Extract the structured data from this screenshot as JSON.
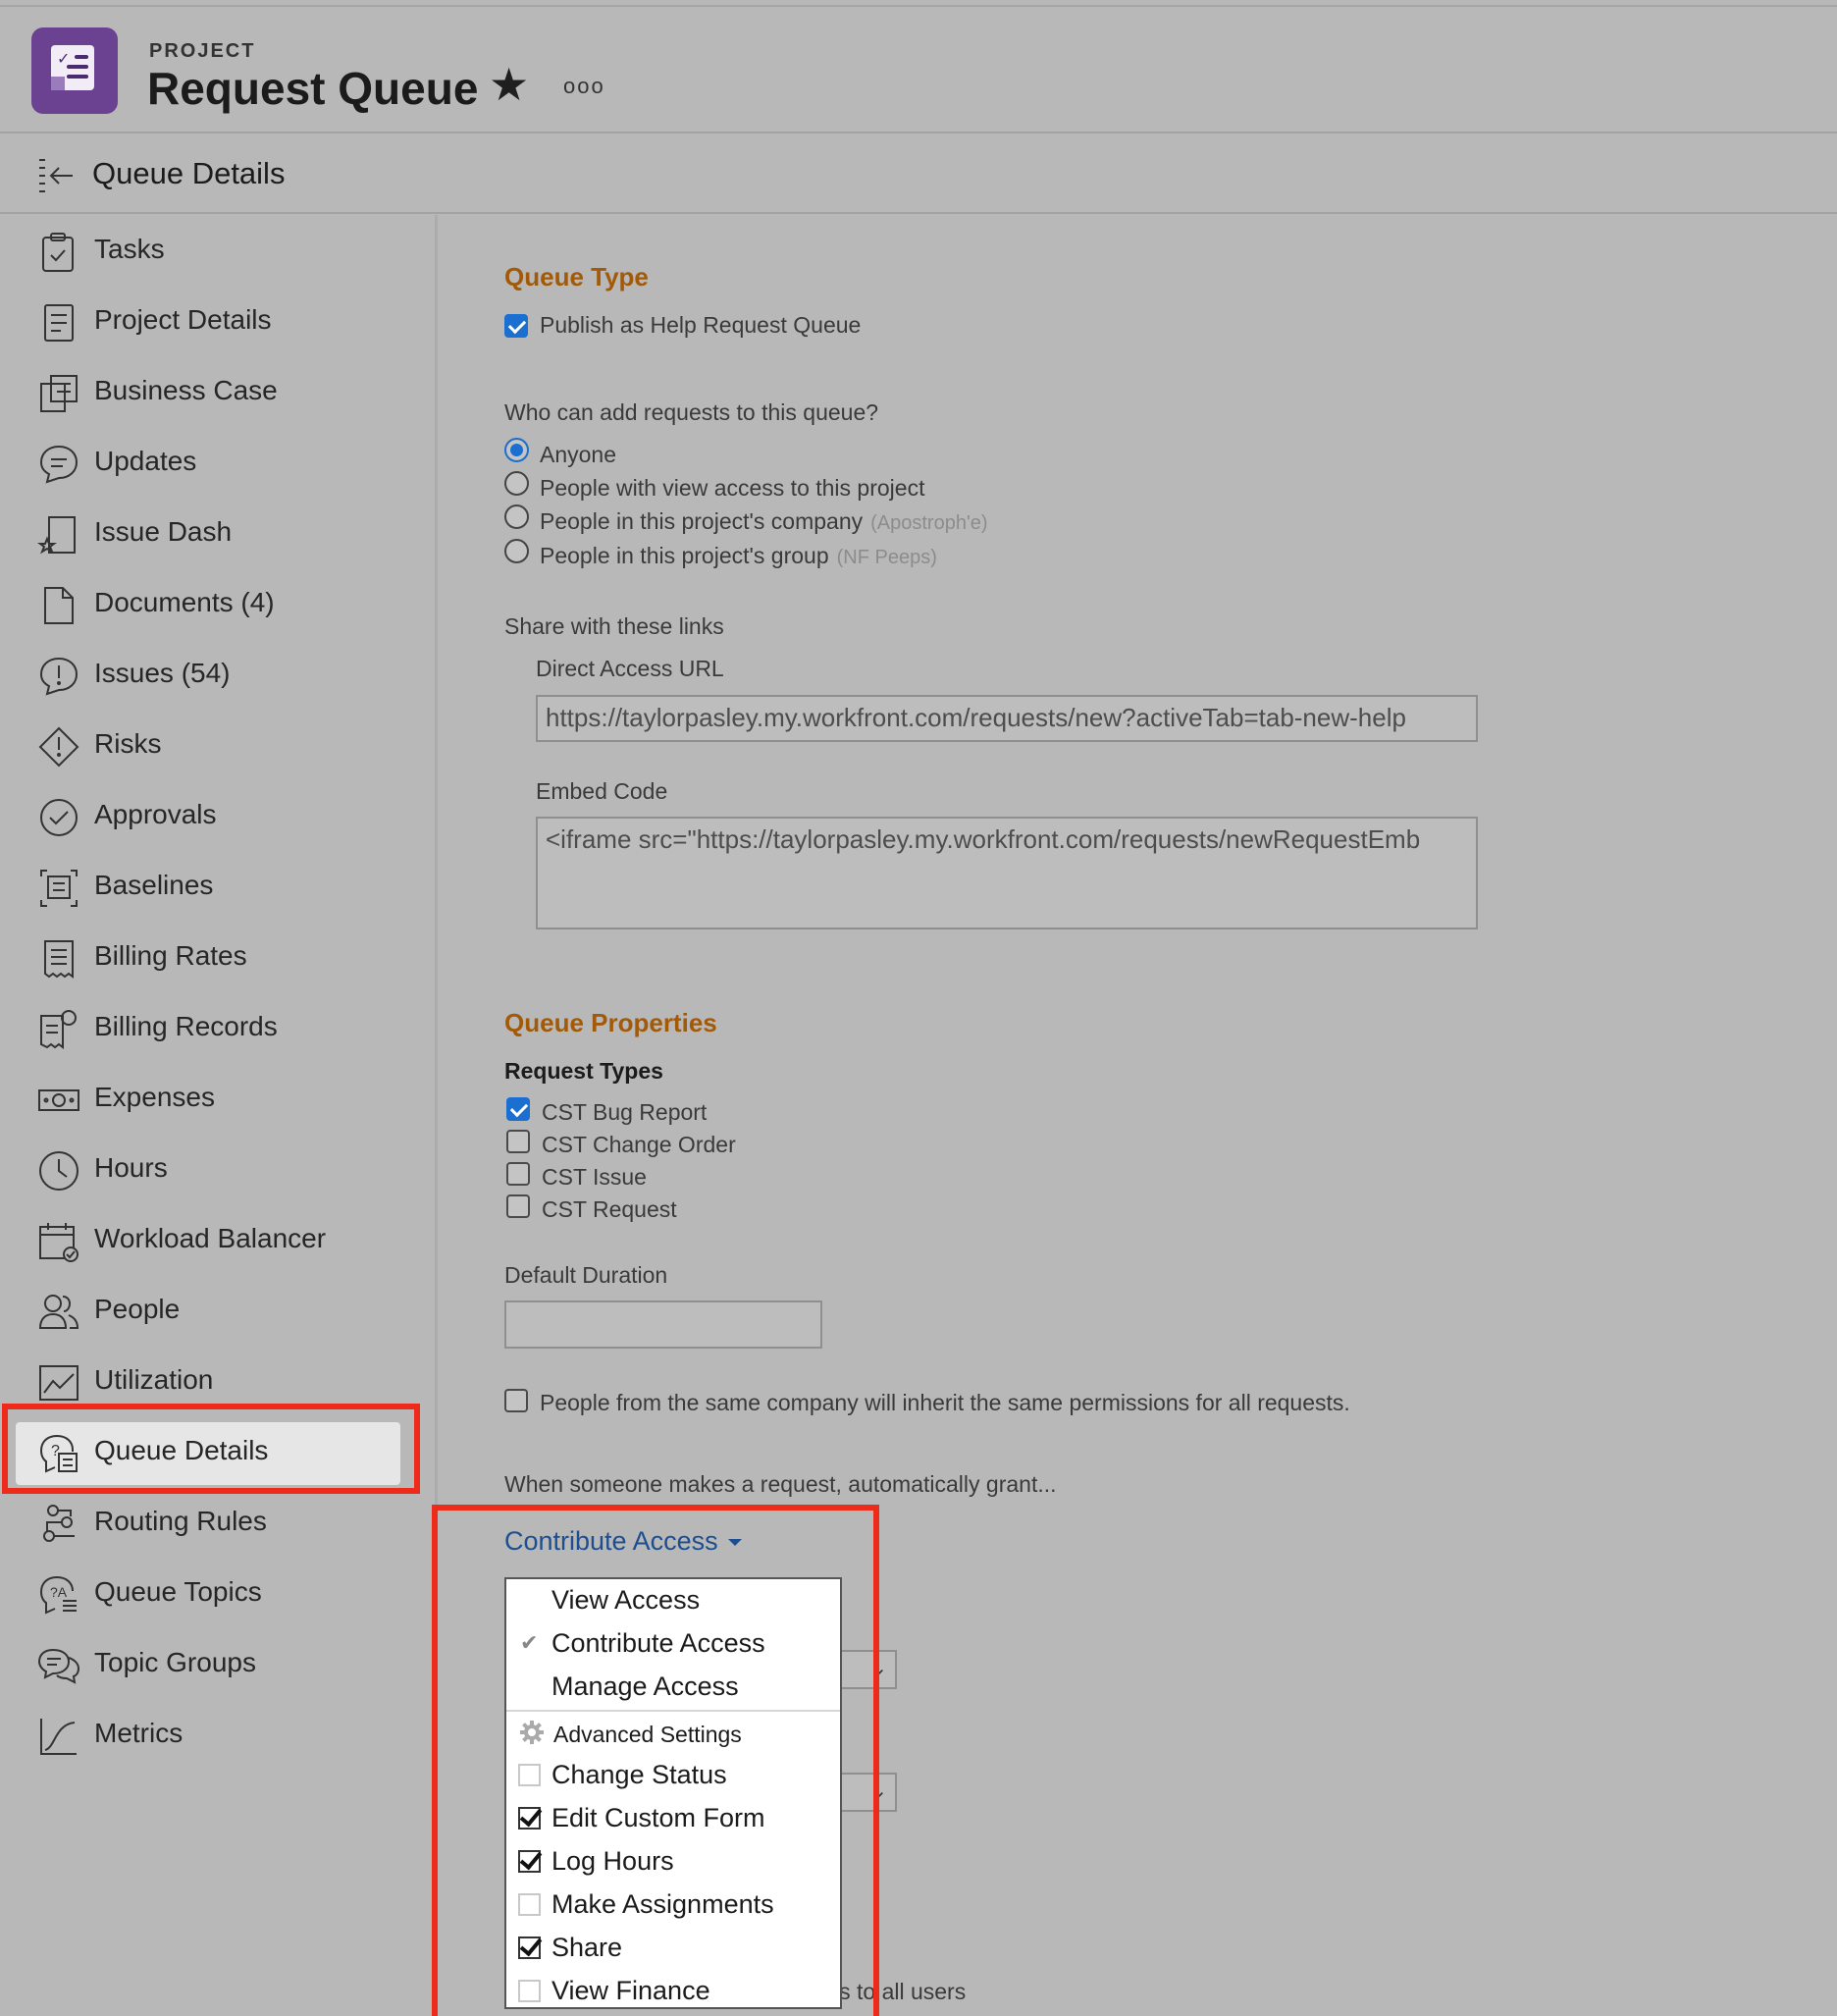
{
  "header": {
    "kicker": "PROJECT",
    "title": "Request Queue",
    "star_icon": "star-icon",
    "more_label": "ooo"
  },
  "subheader": {
    "label": "Queue Details"
  },
  "sidebar": {
    "items": [
      {
        "label": "Tasks",
        "icon": "tasks-icon"
      },
      {
        "label": "Project Details",
        "icon": "project-details-icon"
      },
      {
        "label": "Business Case",
        "icon": "business-case-icon"
      },
      {
        "label": "Updates",
        "icon": "updates-icon"
      },
      {
        "label": "Issue Dash",
        "icon": "issue-dash-icon"
      },
      {
        "label": "Documents (4)",
        "icon": "documents-icon"
      },
      {
        "label": "Issues (54)",
        "icon": "issues-icon"
      },
      {
        "label": "Risks",
        "icon": "risks-icon"
      },
      {
        "label": "Approvals",
        "icon": "approvals-icon"
      },
      {
        "label": "Baselines",
        "icon": "baselines-icon"
      },
      {
        "label": "Billing Rates",
        "icon": "billing-rates-icon"
      },
      {
        "label": "Billing Records",
        "icon": "billing-records-icon"
      },
      {
        "label": "Expenses",
        "icon": "expenses-icon"
      },
      {
        "label": "Hours",
        "icon": "hours-icon"
      },
      {
        "label": "Workload Balancer",
        "icon": "workload-balancer-icon"
      },
      {
        "label": "People",
        "icon": "people-icon"
      },
      {
        "label": "Utilization",
        "icon": "utilization-icon"
      },
      {
        "label": "Queue Details",
        "icon": "queue-details-icon",
        "active": true
      },
      {
        "label": "Routing Rules",
        "icon": "routing-rules-icon"
      },
      {
        "label": "Queue Topics",
        "icon": "queue-topics-icon"
      },
      {
        "label": "Topic Groups",
        "icon": "topic-groups-icon"
      },
      {
        "label": "Metrics",
        "icon": "metrics-icon"
      }
    ]
  },
  "queue_type": {
    "title": "Queue Type",
    "publish_label": "Publish as Help Request Queue",
    "publish_checked": true,
    "who_label": "Who can add requests to this queue?",
    "options": [
      {
        "label": "Anyone",
        "hint": "",
        "selected": true
      },
      {
        "label": "People with view access to this project",
        "hint": "",
        "selected": false
      },
      {
        "label": "People in this project's company",
        "hint": "(Apostroph'e)",
        "selected": false
      },
      {
        "label": "People in this project's group",
        "hint": "(NF Peeps)",
        "selected": false
      }
    ],
    "share_label": "Share with these links",
    "direct_url_label": "Direct Access URL",
    "direct_url_value": "https://taylorpasley.my.workfront.com/requests/new?activeTab=tab-new-help",
    "embed_label": "Embed Code",
    "embed_value": "<iframe src=\"https://taylorpasley.my.workfront.com/requests/newRequestEmb"
  },
  "queue_properties": {
    "title": "Queue Properties",
    "request_types_label": "Request Types",
    "request_types": [
      {
        "label": "CST Bug Report",
        "checked": true
      },
      {
        "label": "CST Change Order",
        "checked": false
      },
      {
        "label": "CST Issue",
        "checked": false
      },
      {
        "label": "CST Request",
        "checked": false
      }
    ],
    "default_duration_label": "Default Duration",
    "default_duration_value": "",
    "inherit_label": "People from the same company will inherit the same permissions for all requests.",
    "inherit_checked": false,
    "grant_label": "When someone makes a request, automatically grant...",
    "access_value": "Contribute Access"
  },
  "dropdown": {
    "levels": [
      {
        "label": "View Access",
        "selected": false
      },
      {
        "label": "Contribute Access",
        "selected": true
      },
      {
        "label": "Manage Access",
        "selected": false
      }
    ],
    "advanced_label": "Advanced Settings",
    "settings": [
      {
        "label": "Change Status",
        "checked": false
      },
      {
        "label": "Edit Custom Form",
        "checked": true
      },
      {
        "label": "Log Hours",
        "checked": true
      },
      {
        "label": "Make Assignments",
        "checked": false
      },
      {
        "label": "Share",
        "checked": true
      },
      {
        "label": "View Finance",
        "checked": false
      }
    ],
    "check_mark": "✔"
  },
  "tail_text": "ls to all users",
  "colors": {
    "highlight": "#ee2b1b",
    "section_title": "#a35a08",
    "link": "#1d4e8f",
    "brand": "#6a4291"
  }
}
